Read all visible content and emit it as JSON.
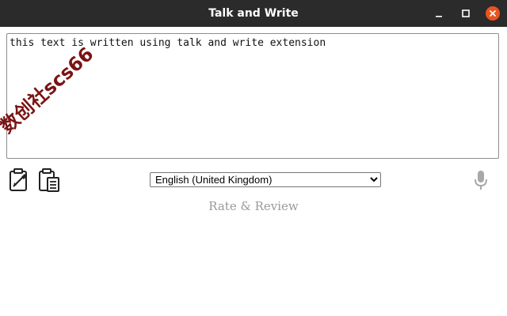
{
  "window": {
    "title": "Talk and Write",
    "colors": {
      "titlebar_bg": "#2b2b2b",
      "close_button": "#e95420"
    },
    "controls": [
      "minimize-icon",
      "maximize-icon",
      "close-icon"
    ]
  },
  "editor": {
    "text": "this text is written using talk and write extension"
  },
  "watermark": {
    "text": "数创社scs66"
  },
  "toolbar": {
    "icons": [
      "paste-icon",
      "copy-icon",
      "microphone-icon"
    ]
  },
  "language": {
    "selected": "English (United Kingdom)"
  },
  "footer": {
    "rate_label": "Rate & Review"
  }
}
